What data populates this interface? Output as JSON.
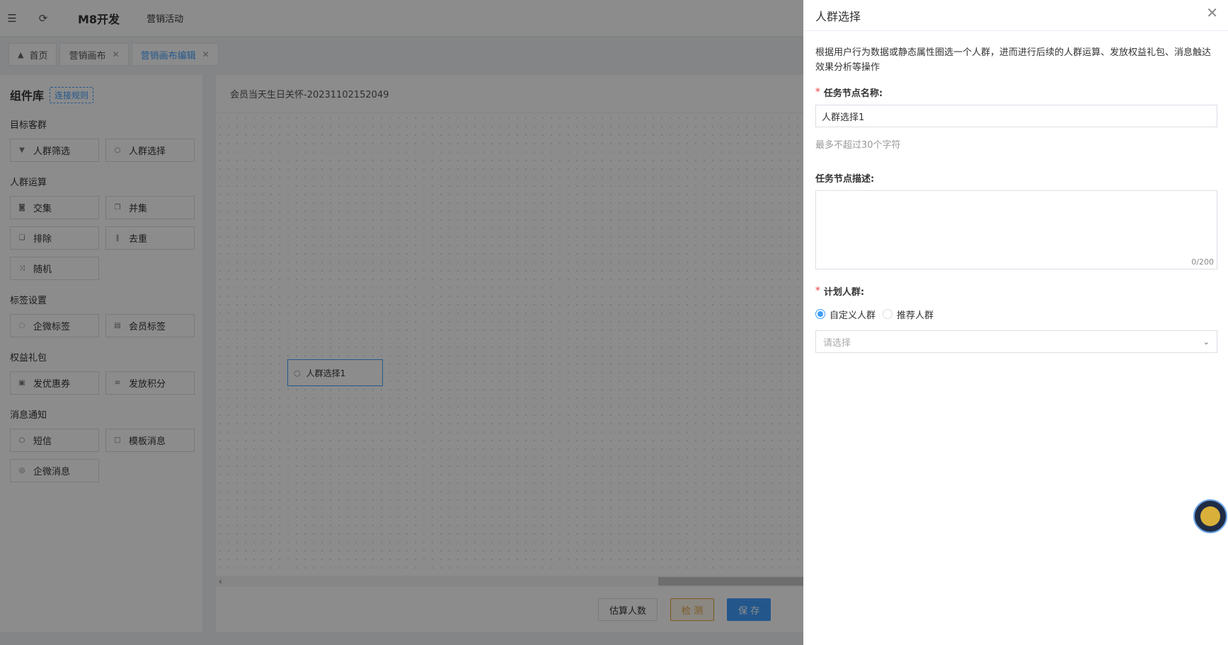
{
  "topbar": {
    "brand": "M8开发",
    "nav_item": "营销活动"
  },
  "tabs": [
    {
      "label": "首页",
      "closable": false,
      "active": false
    },
    {
      "label": "营销画布",
      "closable": true,
      "active": false
    },
    {
      "label": "营销画布编辑",
      "closable": true,
      "active": true
    }
  ],
  "sidebar": {
    "title": "组件库",
    "rule_link": "连接规则",
    "groups": [
      {
        "title": "目标客群",
        "items": [
          "人群筛选",
          "人群选择"
        ]
      },
      {
        "title": "人群运算",
        "items": [
          "交集",
          "并集",
          "排除",
          "去重",
          "随机"
        ]
      },
      {
        "title": "标签设置",
        "items": [
          "企微标签",
          "会员标签"
        ]
      },
      {
        "title": "权益礼包",
        "items": [
          "发优惠券",
          "发放积分"
        ]
      },
      {
        "title": "消息通知",
        "items": [
          "短信",
          "模板消息",
          "企微消息"
        ]
      }
    ]
  },
  "canvas": {
    "title": "会员当天生日关怀-20231102152049",
    "node_label": "人群选择1"
  },
  "footer": {
    "estimate_label": "估算人数",
    "check_label": "检 测",
    "save_label": "保 存"
  },
  "drawer": {
    "title": "人群选择",
    "description": "根据用户行为数据或静态属性圈选一个人群，进而进行后续的人群运算、发放权益礼包、消息触达效果分析等操作",
    "name_label": "任务节点名称:",
    "name_value": "人群选择1",
    "name_hint": "最多不超过30个字符",
    "desc_label": "任务节点描述:",
    "desc_counter": "0/200",
    "crowd_label": "计划人群:",
    "radio_custom": "自定义人群",
    "radio_recommend": "推荐人群",
    "select_placeholder": "请选择"
  },
  "colors": {
    "primary": "#409eff",
    "warning": "#e6a23c",
    "required": "#f56c6c"
  }
}
